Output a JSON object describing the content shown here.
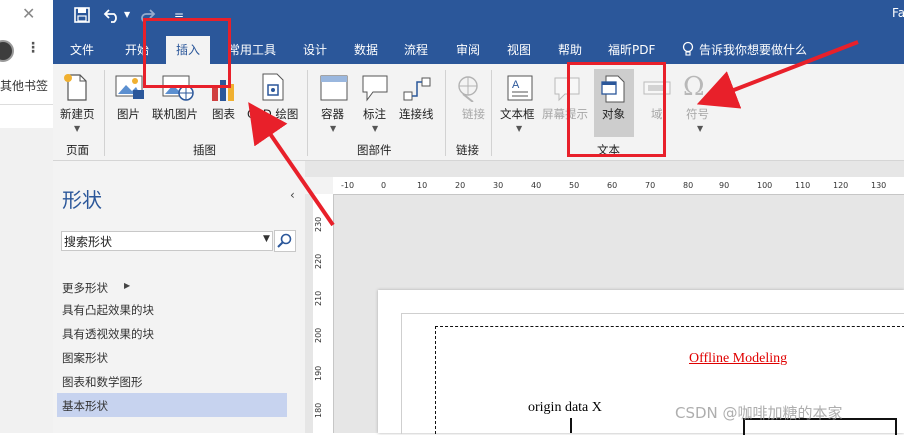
{
  "browser": {
    "close_glyph": "✕",
    "menu_glyph": "⋮",
    "bookmark_label": "其他书签"
  },
  "titlebar": {
    "title_fragment": "Fa",
    "icons": [
      "save-icon",
      "undo-icon",
      "redo-icon",
      "customize-icon"
    ]
  },
  "ribbon_tabs": [
    "文件",
    "开始",
    "插入",
    "常用工具",
    "设计",
    "数据",
    "流程",
    "审阅",
    "视图",
    "帮助",
    "福昕PDF"
  ],
  "active_tab": "插入",
  "tell_me": "告诉我你想要做什么",
  "ribbon": {
    "pages_group": {
      "label": "页面",
      "buttons": [
        "新建页"
      ]
    },
    "illustrations_group": {
      "label": "插图",
      "buttons": [
        "图片",
        "联机图片",
        "图表",
        "CAD 绘图"
      ]
    },
    "diagram_parts_group": {
      "label": "图部件",
      "buttons": [
        "容器",
        "标注",
        "连接线"
      ]
    },
    "links_group": {
      "label": "链接",
      "buttons": [
        "链接"
      ]
    },
    "text_group": {
      "label": "文本",
      "buttons": [
        "文本框",
        "屏幕提示",
        "对象",
        "域",
        "符号"
      ]
    }
  },
  "shapes_pane": {
    "title": "形状",
    "collapse_glyph": "‹",
    "search_placeholder": "搜索形状",
    "more_shapes": "更多形状",
    "stencils": [
      "具有凸起效果的块",
      "具有透视效果的块",
      "图案形状",
      "图表和数学图形",
      "基本形状"
    ],
    "active_stencil": "基本形状"
  },
  "rulers": {
    "horizontal": [
      "-10",
      "0",
      "10",
      "20",
      "30",
      "40",
      "50",
      "60",
      "70",
      "80",
      "90",
      "100",
      "110",
      "120",
      "130"
    ],
    "vertical": [
      "230",
      "220",
      "210",
      "200",
      "190",
      "180"
    ]
  },
  "canvas": {
    "offline_label": "Offline Modeling",
    "origin_label": "origin data X",
    "watermark": "CSDN @咖啡加糖的本家"
  },
  "colors": {
    "ribbon_blue": "#2b579a",
    "annotation_red": "#e8202a",
    "offline_red": "#e00000"
  }
}
